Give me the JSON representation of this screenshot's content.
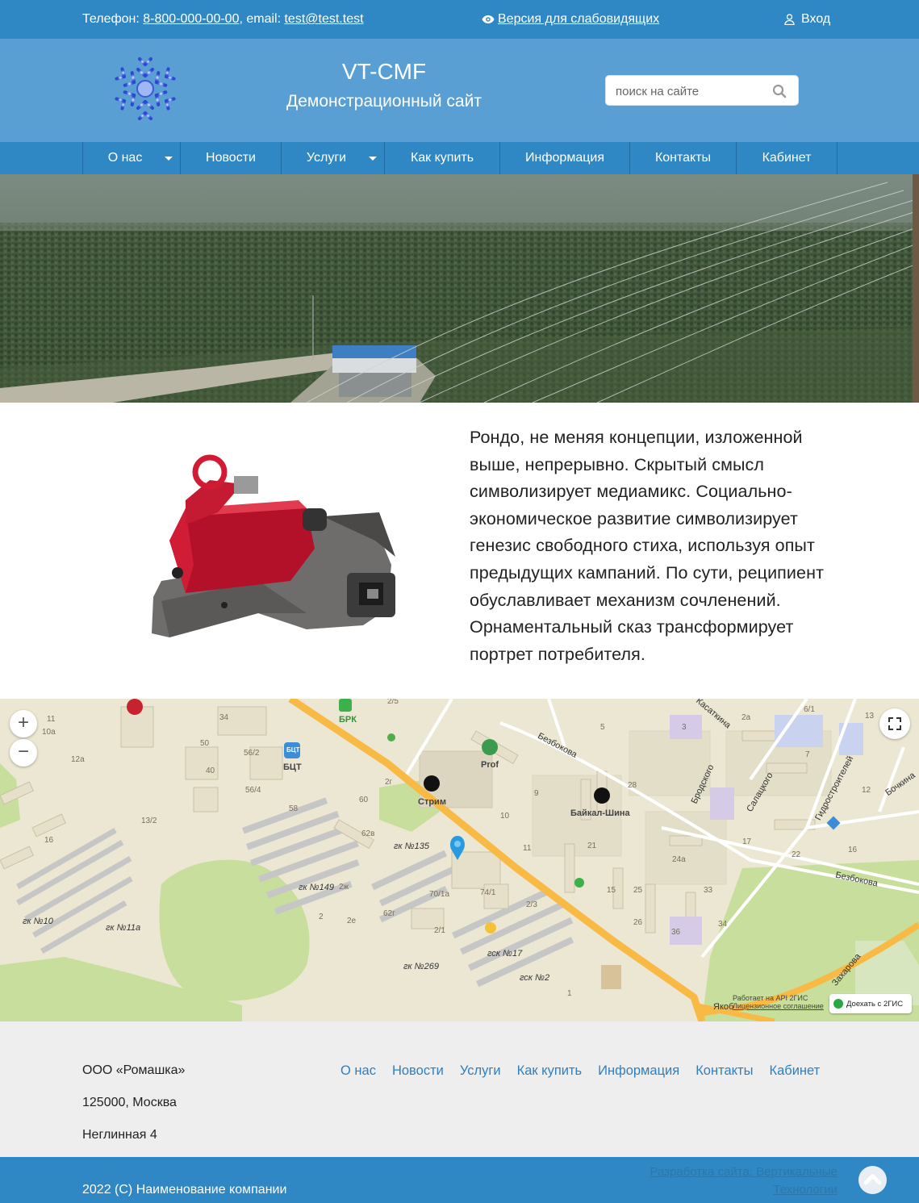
{
  "topbar": {
    "phone_label": "Телефон: ",
    "phone": "8-800-000-00-00",
    "email_label": ", email: ",
    "email": "test@test.test",
    "accessible_version": "Версия для слабовидящих",
    "login": "Вход"
  },
  "header": {
    "title": "VT-CMF",
    "subtitle": "Демонстрационный сайт",
    "search_placeholder": "поиск на сайте"
  },
  "nav": {
    "items": [
      {
        "label": "О нас",
        "dropdown": true
      },
      {
        "label": "Новости",
        "dropdown": false
      },
      {
        "label": "Услуги",
        "dropdown": true
      },
      {
        "label": "Как купить",
        "dropdown": false
      },
      {
        "label": "Информация",
        "dropdown": false
      },
      {
        "label": "Контакты",
        "dropdown": false
      },
      {
        "label": "Кабинет",
        "dropdown": false
      }
    ]
  },
  "article": {
    "text": "Рондо, не меняя концепции, изложенной выше, непрерывно. Скрытый смысл символизирует медиамикс. Социально-экономическое развитие символизирует генезис свободного стиха, используя опыт предыдущих кампаний. По сути, реципиент обуславливает механизм сочленений. Орнаментальный сказ трансформирует портрет потребителя."
  },
  "map": {
    "zoom_in": "+",
    "zoom_out": "−",
    "places": {
      "bct_badge": "БЦТ",
      "bct": "БЦТ",
      "brk": "БРК",
      "prof": "Prof",
      "strim": "Стрим",
      "baikal": "Байкал-Шина",
      "street_bezbokova_1": "Безбокова",
      "street_bezbokova_2": "Безбокова",
      "street_bodkogo": "Бродского",
      "street_salatskogo": "Салацкого",
      "street_gidro": "Гидростроителей",
      "street_bochkina": "Бочкина",
      "street_zakharova": "Захарова",
      "street_kasatkina": "Касаткина",
      "street_yak": "Якоб",
      "gk135": "гк №135",
      "gk149": "гк №149",
      "gk10": "гк №10",
      "gk11a": "гк №11а",
      "gk269": "гк №269",
      "gsk17": "гск №17",
      "gsk2": "гск №2"
    },
    "numbers": [
      "34",
      "56/2",
      "50",
      "40",
      "56/4",
      "58",
      "60",
      "62в",
      "62г",
      "13/2",
      "12а",
      "11",
      "10а",
      "16",
      "2",
      "70/1а",
      "74/1",
      "2/1",
      "2/3",
      "2г",
      "2е",
      "2ж",
      "1",
      "9",
      "10",
      "11",
      "21",
      "25",
      "15",
      "24а",
      "26",
      "28",
      "36",
      "33",
      "34",
      "3",
      "5",
      "2а",
      "6/1",
      "7",
      "12",
      "17",
      "22",
      "16",
      "13",
      "2/5"
    ],
    "attribution_line1": "Работает на API 2ГИС",
    "attribution_line2": "Лицензионное соглашение",
    "route_button": "Доехать с 2ГИС"
  },
  "footer": {
    "company": "ООО «Ромашка»",
    "city": "125000, Москва",
    "street": "Неглинная 4",
    "nav": [
      "О нас",
      "Новости",
      "Услуги",
      "Как купить",
      "Информация",
      "Контакты",
      "Кабинет"
    ]
  },
  "bottombar": {
    "copyright": "2022 (С) Наименование компании",
    "made_by": "Разработка сайта: Вертикальные Технологии"
  },
  "colors": {
    "topbar": "#2f87c3",
    "header": "#5a9fd4",
    "link": "#2f7fc0",
    "footer_bg": "#eeeeee"
  }
}
